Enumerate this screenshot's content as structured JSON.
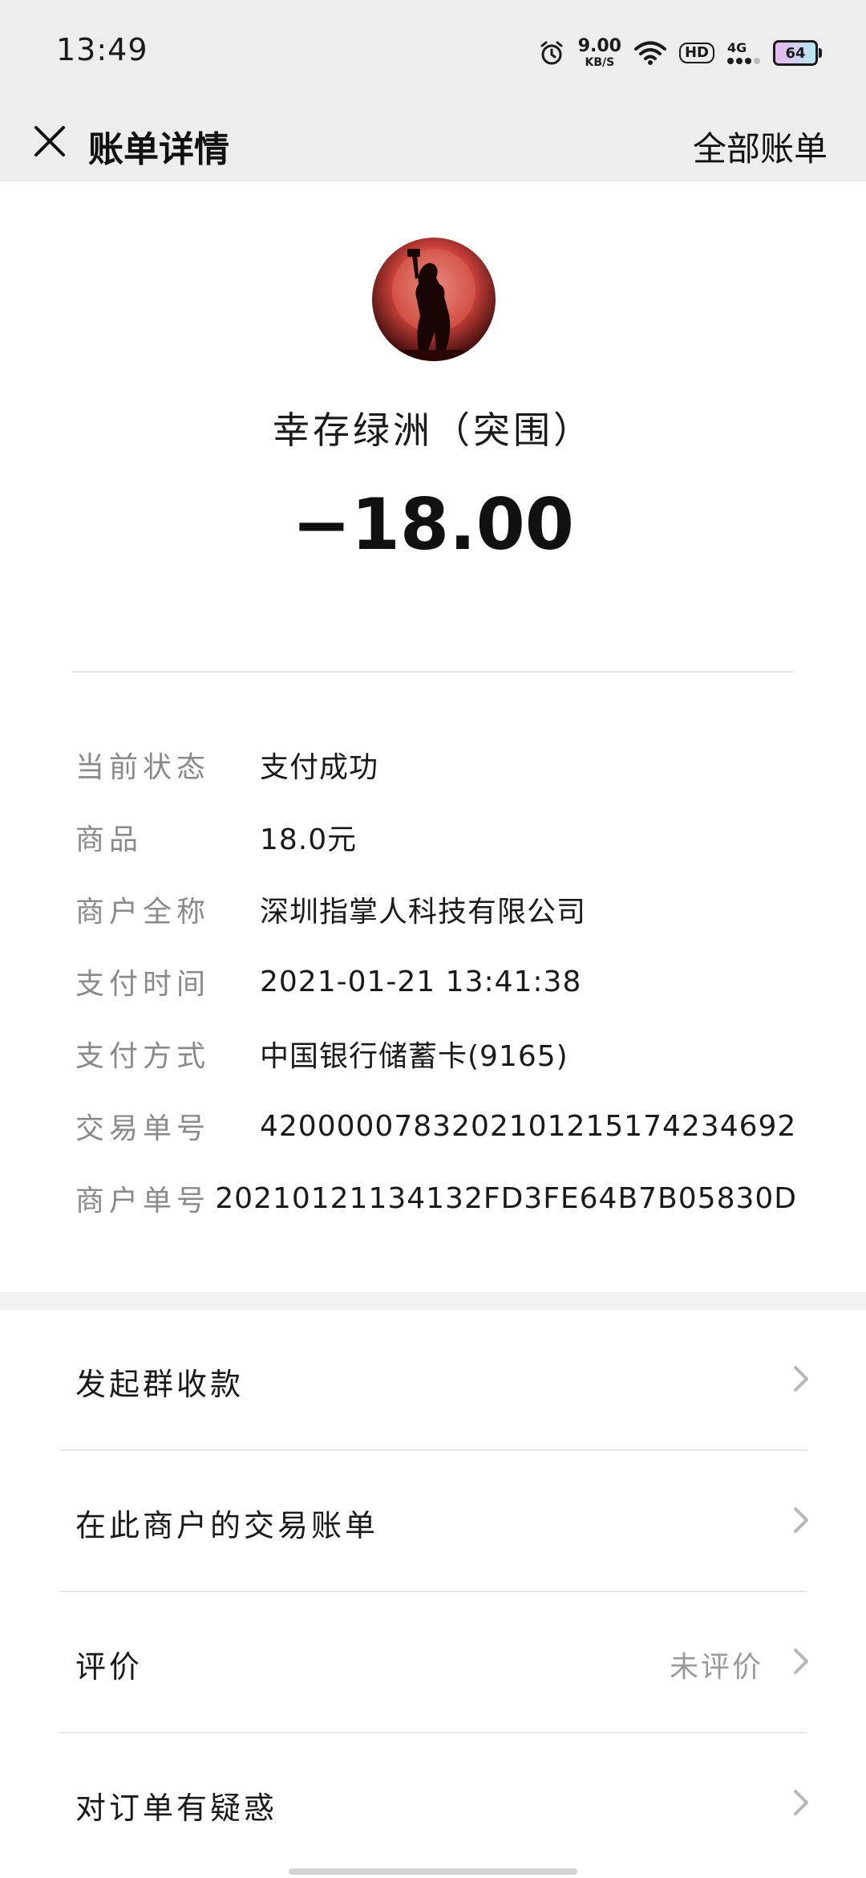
{
  "status_bar": {
    "time": "13:49",
    "net_speed_value": "9.00",
    "net_speed_unit": "KB/S",
    "hd_label": "HD",
    "network_label": "4G",
    "battery_level": "64",
    "icons": [
      "alarm-icon",
      "wifi-icon",
      "hd-icon",
      "signal-icon",
      "battery-icon"
    ]
  },
  "nav": {
    "title": "账单详情",
    "all_bills_label": "全部账单",
    "close_icon": "close-icon"
  },
  "merchant": {
    "name": "幸存绿洲（突围）",
    "amount": "−18.00"
  },
  "details": [
    {
      "label": "当前状态",
      "value": "支付成功"
    },
    {
      "label": "商品",
      "value": "18.0元"
    },
    {
      "label": "商户全称",
      "value": "深圳指掌人科技有限公司"
    },
    {
      "label": "支付时间",
      "value": "2021-01-21 13:41:38"
    },
    {
      "label": "支付方式",
      "value": "中国银行储蓄卡(9165)"
    },
    {
      "label": "交易单号",
      "value": "4200000783202101215174234692"
    },
    {
      "label": "商户单号",
      "value": "20210121134132FD3FE64B7B05830D"
    }
  ],
  "actions": [
    {
      "label": "发起群收款",
      "hint": ""
    },
    {
      "label": "在此商户的交易账单",
      "hint": ""
    },
    {
      "label": "评价",
      "hint": "未评价"
    },
    {
      "label": "对订单有疑惑",
      "hint": ""
    }
  ],
  "colors": {
    "header_bg": "#ededed",
    "label_gray": "#8a8a8a",
    "text_dark": "#1a1a1a",
    "divider": "#e6e6e6"
  }
}
